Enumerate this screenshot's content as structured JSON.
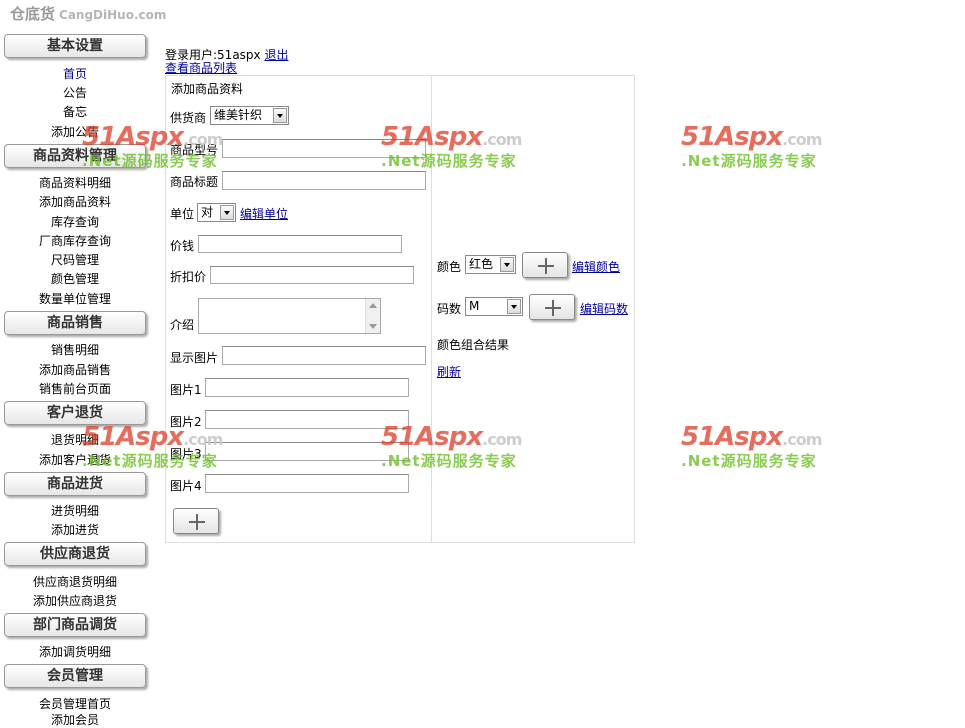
{
  "logo": {
    "brand": "仓底货",
    "site": "CangDiHuo.com"
  },
  "sidebar": {
    "groups": [
      {
        "title": "基本设置",
        "items": [
          "首页",
          "公告",
          "备忘",
          "添加公告"
        ]
      },
      {
        "title": "商品资料管理",
        "items": [
          "商品资料明细",
          "添加商品资料",
          "库存查询",
          "厂商库存查询",
          "尺码管理",
          "颜色管理",
          "数量单位管理"
        ]
      },
      {
        "title": "商品销售",
        "items": [
          "销售明细",
          "添加商品销售",
          "销售前台页面"
        ]
      },
      {
        "title": "客户退货",
        "items": [
          "退货明细",
          "添加客户退货"
        ]
      },
      {
        "title": "商品进货",
        "items": [
          "进货明细",
          "添加进货"
        ]
      },
      {
        "title": "供应商退货",
        "items": [
          "供应商退货明细",
          "添加供应商退货"
        ]
      },
      {
        "title": "部门商品调货",
        "items": [
          "添加调货明细"
        ]
      },
      {
        "title": "会员管理",
        "items": [
          "会员管理首页",
          "添加会员"
        ]
      }
    ]
  },
  "header": {
    "login_label": "登录用户:51aspx",
    "logout": "退出",
    "product_list_link": "查看商品列表"
  },
  "form": {
    "title": "添加商品资料",
    "supplier_label": "供货商",
    "supplier_value": "维美针织",
    "model_label": "商品型号",
    "name_label": "商品标题",
    "unit_label": "单位",
    "unit_value": "对",
    "edit_unit": "编辑单位",
    "price_label": "价钱",
    "discount_label": "折扣价",
    "intro_label": "介绍",
    "display_image_label": "显示图片",
    "image1_label": "图片1",
    "image2_label": "图片2",
    "image3_label": "图片3",
    "image4_label": "图片4",
    "color_label": "颜色",
    "color_value": "红色",
    "edit_color": "编辑颜色",
    "size_label": "码数",
    "size_value": "M",
    "edit_size": "编辑码数",
    "color_result_label": "颜色组合结果",
    "refresh": "刷新"
  },
  "watermark": {
    "logo": "51Aspx",
    "domain": ".com",
    "slogan": ".Net源码服务专家"
  }
}
